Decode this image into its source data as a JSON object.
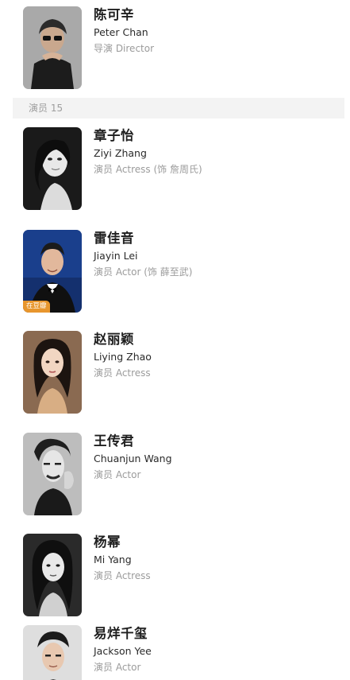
{
  "director": {
    "name_zh": "陈可辛",
    "name_en": "Peter Chan",
    "role": "导演 Director",
    "photo_icon": "portrait-photo"
  },
  "cast_section": {
    "label": "演员 15"
  },
  "cast": [
    {
      "name_zh": "章子怡",
      "name_en": "Ziyi Zhang",
      "role": "演员 Actress (饰 詹周氏)"
    },
    {
      "name_zh": "雷佳音",
      "name_en": "Jiayin Lei",
      "role": "演员 Actor (饰 薛至武)",
      "badge": "在豆瓣"
    },
    {
      "name_zh": "赵丽颖",
      "name_en": "Liying Zhao",
      "role": "演员 Actress"
    },
    {
      "name_zh": "王传君",
      "name_en": "Chuanjun Wang",
      "role": "演员 Actor"
    },
    {
      "name_zh": "杨幂",
      "name_en": "Mi Yang",
      "role": "演员 Actress"
    },
    {
      "name_zh": "易烊千玺",
      "name_en": "Jackson Yee",
      "role": "演员 Actor"
    }
  ],
  "colors": {
    "section_bg": "#f3f3f3",
    "badge_bg": "#e8962d",
    "role_text": "#9b9b9b"
  }
}
